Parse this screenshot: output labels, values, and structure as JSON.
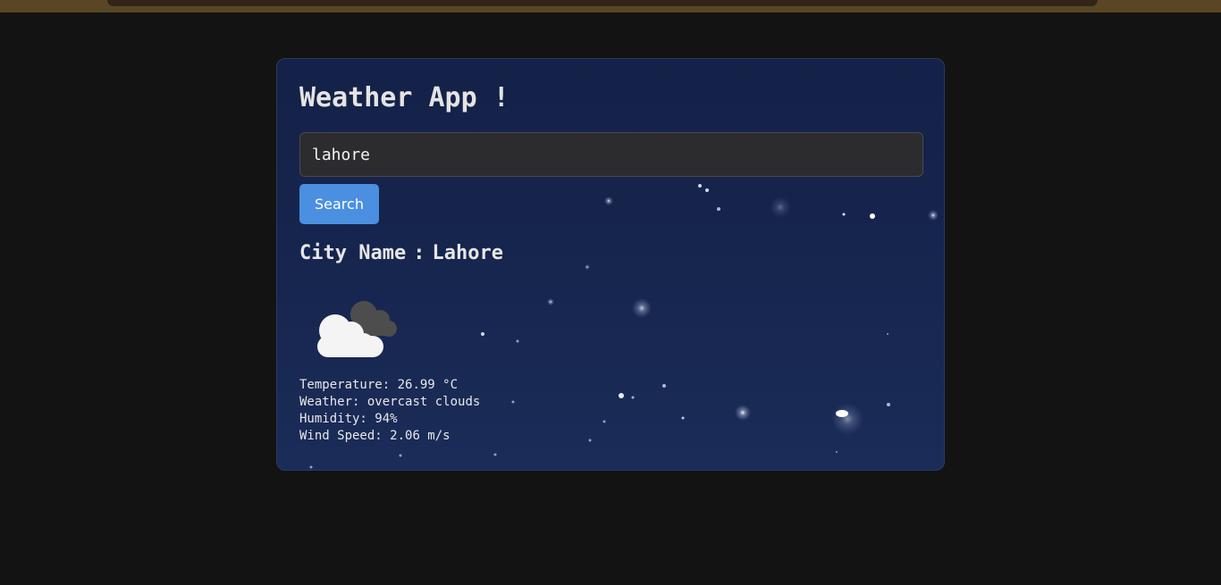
{
  "app": {
    "title": "Weather App !"
  },
  "search": {
    "value": "lahore",
    "button_label": "Search"
  },
  "result": {
    "city_label": "City Name",
    "city_separator": ":",
    "city_value": "Lahore",
    "icon": "overcast-clouds-icon",
    "temperature_label": "Temperature:",
    "temperature_value": "26.99 °C",
    "weather_label": "Weather:",
    "weather_value": "overcast clouds",
    "humidity_label": "Humidity:",
    "humidity_value": "94%",
    "wind_label": "Wind Speed:",
    "wind_value": "2.06 m/s"
  },
  "colors": {
    "page_background": "#131313",
    "card_background": "#16244d",
    "button": "#4a8fe0",
    "input_background": "#2c2c2e"
  }
}
